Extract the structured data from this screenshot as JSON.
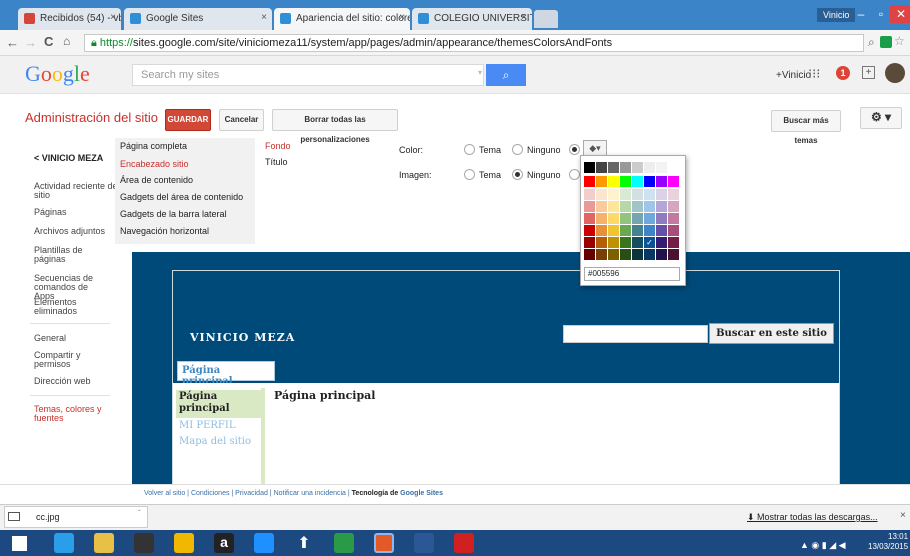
{
  "browser": {
    "tabs": [
      {
        "label": "Recibidos (54) - vbmeza:",
        "icon": "gmail-icon",
        "color": "#d44638"
      },
      {
        "label": "Google Sites",
        "icon": "sites-icon",
        "color": "#2f8ed8"
      },
      {
        "label": "Apariencia del sitio: colore",
        "icon": "sites-icon",
        "color": "#2f8ed8"
      },
      {
        "label": "COLEGIO UNIVERSITARIO",
        "icon": "sites-icon",
        "color": "#2f8ed8"
      }
    ],
    "tab_close": "×",
    "window_user": "Vinicio",
    "url_secure": "https://",
    "url_rest": "sites.google.com/site/viniciomeza11/system/app/pages/admin/appearance/themesColorsAndFonts"
  },
  "google": {
    "logo": "Google",
    "search_placeholder": "Search my sites",
    "user": "+Vinicio",
    "notification_count": "1"
  },
  "admin": {
    "title": "Administración del sitio",
    "save": "GUARDAR",
    "cancel": "Cancelar",
    "reset": "Borrar todas las personalizaciones",
    "more_themes": "Buscar más temas"
  },
  "sidebar": {
    "site_name": "< VINICIO MEZA",
    "items": [
      "Actividad reciente del sitio",
      "Páginas",
      "Archivos adjuntos",
      "Plantillas de páginas",
      "Secuencias de comandos de Apps",
      "Elementos eliminados",
      "General",
      "Compartir y permisos",
      "Dirección web",
      "Temas, colores y fuentes"
    ]
  },
  "sections": {
    "items": [
      "Página completa",
      "Encabezado sitio",
      "Área de contenido",
      "Gadgets del área de contenido",
      "Gadgets de la barra lateral",
      "Navegación horizontal"
    ],
    "sub": [
      "Fondo",
      "Título"
    ]
  },
  "color_panel": {
    "color_label": "Color:",
    "image_label": "Imagen:",
    "opt_theme": "Tema",
    "opt_none": "Ninguno"
  },
  "picker": {
    "hex_value": "#005596",
    "check": "✓",
    "grays": [
      "#000000",
      "#444444",
      "#666666",
      "#999999",
      "#cccccc",
      "#eeeeee",
      "#f3f3f3",
      "#ffffff"
    ],
    "rows": [
      [
        "#ff0000",
        "#ff9900",
        "#ffff00",
        "#00ff00",
        "#00ffff",
        "#0000ff",
        "#9900ff",
        "#ff00ff"
      ],
      [
        "#f4cccc",
        "#fce5cd",
        "#fff2cc",
        "#d9ead3",
        "#d0e0e3",
        "#cfe2f3",
        "#d9d2e9",
        "#ead1dc"
      ],
      [
        "#ea9999",
        "#f9cb9c",
        "#ffe599",
        "#b6d7a8",
        "#a2c4c9",
        "#9fc5e8",
        "#b4a7d6",
        "#d5a6bd"
      ],
      [
        "#e06666",
        "#f6b26b",
        "#ffd966",
        "#93c47d",
        "#76a5af",
        "#6fa8dc",
        "#8e7cc3",
        "#c27ba0"
      ],
      [
        "#cc0000",
        "#e69138",
        "#f1c232",
        "#6aa84f",
        "#45818e",
        "#3d85c6",
        "#674ea7",
        "#a64d79"
      ],
      [
        "#990000",
        "#b45f06",
        "#bf9000",
        "#38761d",
        "#134f5c",
        "#0b5394",
        "#351c75",
        "#741b47"
      ],
      [
        "#660000",
        "#783f04",
        "#7f6000",
        "#274e13",
        "#0c343d",
        "#073763",
        "#20124d",
        "#4c1130"
      ]
    ]
  },
  "preview": {
    "site_title": "VINICIO MEZA",
    "search_button": "Buscar en este sitio",
    "nav_tab": "Página principal",
    "side_items": [
      "Página principal",
      "MI PERFIL",
      "Mapa del sitio"
    ],
    "page_heading": "Página principal"
  },
  "footer": {
    "links": "Volver al sitio | Condiciones | Privacidad | Notificar una incidencia |",
    "brand_prefix": "Tecnología de",
    "brand": "Google Sites"
  },
  "downloads": {
    "file": "cc.jpg",
    "show_all": "Mostrar todas las descargas..."
  },
  "taskbar": {
    "time": "13:01",
    "date": "13/03/2015"
  }
}
